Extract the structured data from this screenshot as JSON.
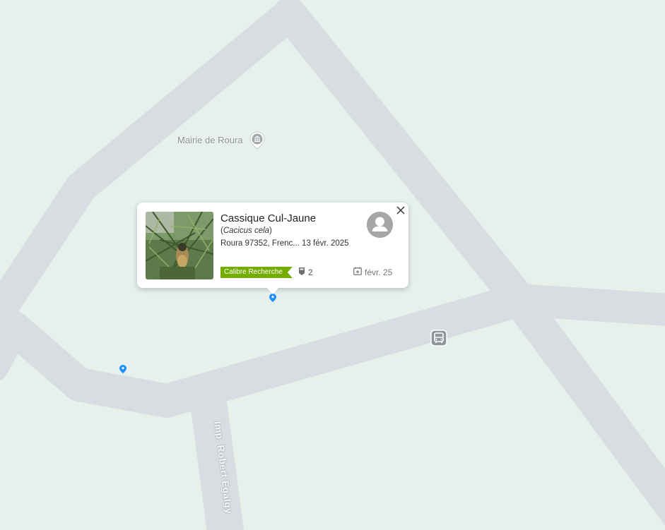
{
  "map": {
    "colors": {
      "land": "#e6f1eb",
      "road": "#d9dce0",
      "marker": "#1e90ff",
      "poi_icon": "#9aa0a6"
    },
    "poi": {
      "label": "Mairie de Roura",
      "icon": "town-hall-icon"
    },
    "street_label": "Imp. Robert Egalgy",
    "transit_icon": "bus-stop-icon"
  },
  "popup": {
    "common_name": "Cassique Cul-Jaune",
    "scientific_open": "(",
    "scientific_name": "Cacicus cela",
    "scientific_close": ")",
    "place_date": "Roura 97352, Frenc... 13 févr. 2025",
    "quality_grade": "Calibre Recherche",
    "identifications_count": "2",
    "observed_date_short": "févr. 25",
    "quality_color": "#74ac00",
    "icons": {
      "close": "close-icon",
      "avatar": "user-avatar-icon",
      "identifications": "identification-icon",
      "calendar": "calendar-icon",
      "photo": "observation-photo"
    }
  }
}
